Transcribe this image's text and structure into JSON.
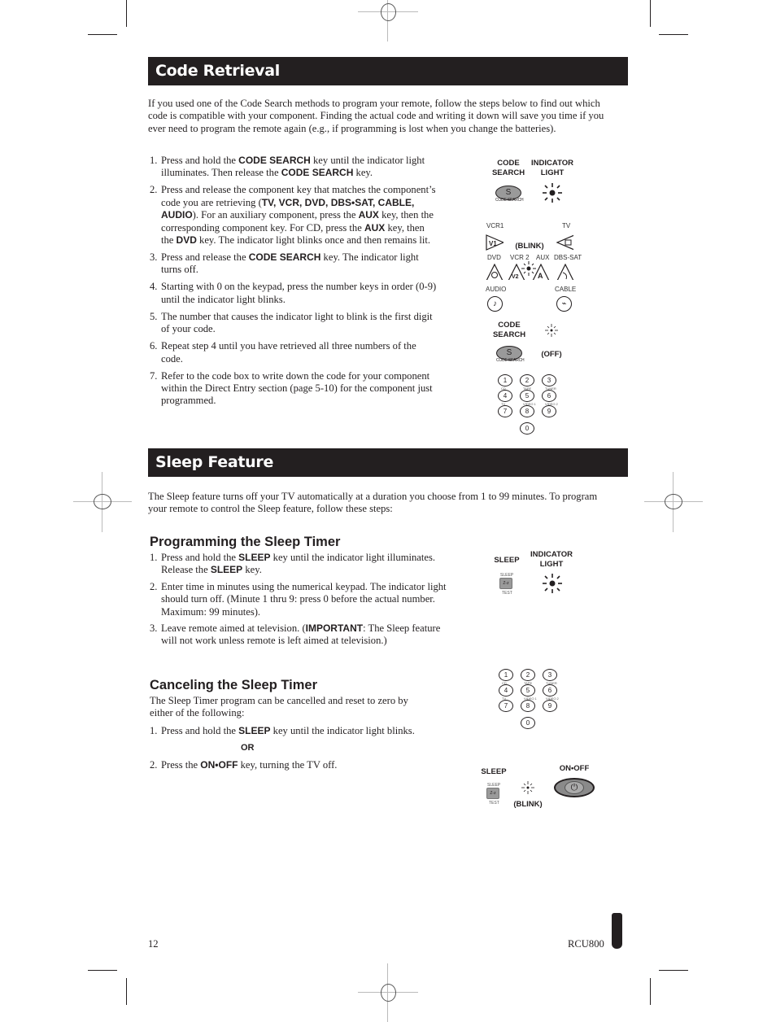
{
  "code_retrieval": {
    "title": "Code Retrieval",
    "intro": "If you used one of the Code Search methods to program your remote, follow the steps below to find out which code is compatible with your component. Finding the actual code and writing it down will save you time if you ever need to program the remote again (e.g., if programming is lost when you change the batteries).",
    "steps": [
      {
        "num": "1.",
        "parts": [
          "Press and hold the ",
          "CODE SEARCH",
          " key until the indicator light illuminates. Then release the ",
          "CODE SEARCH",
          " key."
        ]
      },
      {
        "num": "2.",
        "parts": [
          "Press and release the component key that matches the component’s code you are retrieving (",
          "TV, VCR, DVD, DBS•SAT, CABLE, AUDIO",
          "). For an auxiliary component, press the ",
          "AUX",
          " key, then the corresponding component key. For CD, press the ",
          "AUX",
          " key, then the ",
          "DVD",
          " key. The indicator light blinks once and then remains lit."
        ]
      },
      {
        "num": "3.",
        "parts": [
          "Press and release the ",
          "CODE SEARCH",
          " key. The indicator light turns off."
        ]
      },
      {
        "num": "4.",
        "parts": [
          "Starting with 0 on the keypad, press the number keys in order (0-9) until the indicator light blinks."
        ]
      },
      {
        "num": "5.",
        "parts": [
          "The number that causes the indicator light to blink is the first digit of your code."
        ]
      },
      {
        "num": "6.",
        "parts": [
          "Repeat step 4 until you have retrieved all three numbers of the code."
        ]
      },
      {
        "num": "7.",
        "parts": [
          "Refer to the code box to write down the code for your component within the Direct Entry section (page 5-10) for the component just programmed."
        ]
      }
    ],
    "figure": {
      "code_search_label": "CODE\nSEARCH",
      "indicator_light_label": "INDICATOR\nLIGHT",
      "code_search_key": "S",
      "code_search_key_caption": "CODE SEARCH",
      "vcr1": "VCR1",
      "tv": "TV",
      "blink": "(BLINK)",
      "dvd": "DVD",
      "vcr2": "VCR 2",
      "aux": "AUX",
      "dbs_sat": "DBS-SAT",
      "audio": "AUDIO",
      "cable": "CABLE",
      "v1": "V1",
      "v2": "V2",
      "a": "A",
      "off": "(OFF)",
      "keypad": [
        "1",
        "2",
        "3",
        "4",
        "5",
        "6",
        "7",
        "8",
        "9",
        "0"
      ],
      "keypad_captions": [
        "CD",
        "TAPE",
        "TUNER",
        "TV",
        "VIDEO 1",
        "VIDEO 2"
      ]
    }
  },
  "sleep_feature": {
    "title": "Sleep Feature",
    "intro": "The Sleep feature turns off your TV automatically at a duration you choose from 1 to 99 minutes. To program your remote to control the Sleep feature, follow these steps:",
    "programming": {
      "heading": "Programming the Sleep Timer",
      "steps": [
        {
          "num": "1.",
          "parts": [
            "Press and hold the ",
            "SLEEP",
            " key until the indicator light illuminates. Release the ",
            "SLEEP",
            " key."
          ]
        },
        {
          "num": "2.",
          "parts": [
            "Enter time in minutes using the numerical keypad. The indicator light should turn off. (Minute 1 thru 9: press 0 before the actual number. Maximum: 99 minutes)."
          ]
        },
        {
          "num": "3.",
          "parts": [
            "Leave remote aimed at television. (",
            "IMPORTANT",
            ": The Sleep feature will not work unless remote is left aimed at television.)"
          ]
        }
      ],
      "figure": {
        "sleep_label": "SLEEP",
        "indicator_light_label": "INDICATOR\nLIGHT",
        "sleep_key_top": "SLEEP",
        "sleep_key": "Z-z",
        "sleep_key_bottom": "TEST"
      }
    },
    "canceling": {
      "heading": "Canceling the Sleep Timer",
      "intro": "The Sleep Timer program can be cancelled and reset to zero by either of the following:",
      "step1": {
        "num": "1.",
        "parts": [
          "Press and hold the ",
          "SLEEP",
          " key until the indicator light blinks."
        ]
      },
      "or": "OR",
      "step2": {
        "num": "2.",
        "parts": [
          "Press the ",
          "ON•OFF",
          " key, turning the TV off."
        ]
      },
      "figure": {
        "sleep_label": "SLEEP",
        "blink": "(BLINK)",
        "onoff_label": "ON•OFF",
        "power_glyph": "⏻"
      }
    }
  },
  "footer": {
    "page_number": "12",
    "model": "RCU800"
  }
}
